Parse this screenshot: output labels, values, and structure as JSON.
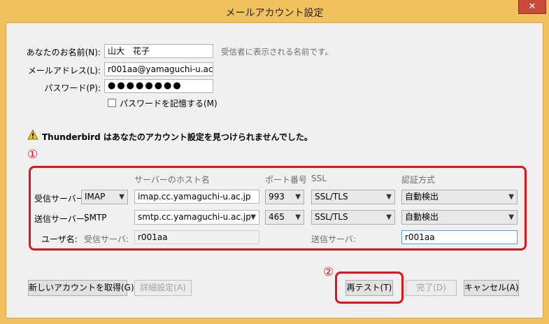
{
  "window": {
    "title": "メールアカウント設定",
    "close_glyph": "✕"
  },
  "form": {
    "name_label": "あなたのお名前(N):",
    "name_value": "山大　花子",
    "name_hint": "受信者に表示される名前です。",
    "email_label": "メールアドレス(L):",
    "email_value": "r001aa@yamaguchi-u.ac",
    "password_label": "パスワード(P):",
    "password_value": "●●●●●●●●",
    "remember_label": "パスワードを記憶する(M)"
  },
  "warning": {
    "message": "Thunderbird はあなたのアカウント設定を見つけられませんでした。"
  },
  "annotations": {
    "marker1": "①",
    "marker2": "②",
    "color": "#e0141e"
  },
  "servers": {
    "headers": {
      "host": "サーバーのホスト名",
      "port": "ポート番号",
      "ssl": "SSL",
      "auth": "認証方式"
    },
    "incoming": {
      "label": "受信サーバー:",
      "protocol": "IMAP",
      "host": "imap.cc.yamaguchi-u.ac.jp",
      "port": "993",
      "ssl": "SSL/TLS",
      "auth": "自動検出"
    },
    "outgoing": {
      "label": "送信サーバー:",
      "protocol": "SMTP",
      "host": "smtp.cc.yamaguchi-u.ac.jp",
      "port": "465",
      "ssl": "SSL/TLS",
      "auth": "自動検出"
    },
    "username": {
      "label": "ユーザ名:",
      "incoming_label": "受信サーバ:",
      "incoming_value": "r001aa",
      "outgoing_label": "送信サーバ:",
      "outgoing_value": "r001aa"
    }
  },
  "buttons": {
    "new_account": "新しいアカウントを取得(G)",
    "advanced": "詳細設定(A)",
    "retest": "再テスト(T)",
    "done": "完了(D)",
    "cancel": "キャンセル(A)"
  }
}
